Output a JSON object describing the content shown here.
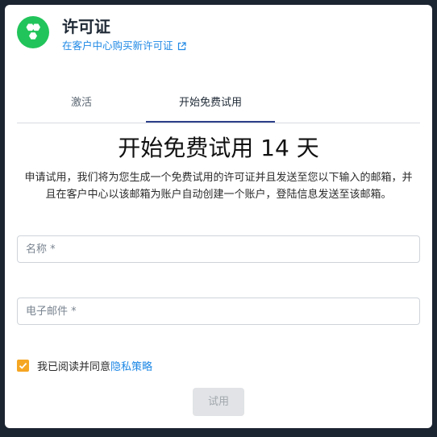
{
  "header": {
    "logo_icon": "honeycomb-icon",
    "title": "许可证",
    "buy_link": "在客户中心购买新许可证",
    "buy_link_icon": "external-link-icon"
  },
  "tabs": [
    {
      "label": "激活",
      "active": false
    },
    {
      "label": "开始免费试用",
      "active": true
    }
  ],
  "trial": {
    "heading": "开始免费试用 14 天",
    "description": "申请试用，我们将为您生成一个免费试用的许可证并且发送至您以下输入的邮箱，并且在客户中心以该邮箱为账户自动创建一个账户，登陆信息发送至该邮箱。"
  },
  "form": {
    "name_placeholder": "名称 *",
    "name_value": "",
    "email_placeholder": "电子邮件 *",
    "email_value": ""
  },
  "agreement": {
    "checked": true,
    "text": "我已阅读并同意",
    "link": "隐私策略"
  },
  "submit_label": "试用",
  "colors": {
    "backdrop": "#1b2431",
    "logo": "#21c45a",
    "link": "#1e88e5",
    "checkbox": "#f5a623",
    "tab_underline": "#2d3f8a"
  }
}
